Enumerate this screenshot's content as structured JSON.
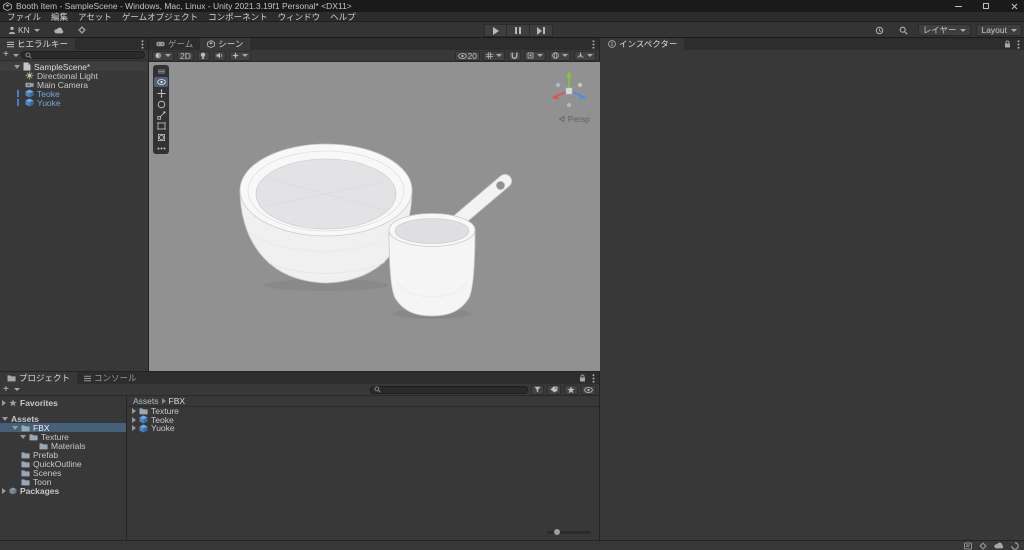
{
  "window": {
    "title": "Booth Item - SampleScene - Windows, Mac, Linux - Unity 2021.3.19f1 Personal* <DX11>"
  },
  "menu": {
    "items": [
      "ファイル",
      "編集",
      "アセット",
      "ゲームオブジェクト",
      "コンポーネント",
      "ウィンドウ",
      "ヘルプ"
    ]
  },
  "toolbar": {
    "account_label": "KN",
    "layers_label": "レイヤー",
    "layout_label": "Layout"
  },
  "hierarchy": {
    "tab_label": "ヒエラルキー",
    "create_label": "+",
    "scene_name": "SampleScene*",
    "items": [
      {
        "name": "Directional Light"
      },
      {
        "name": "Main Camera"
      },
      {
        "name": "Teoke"
      },
      {
        "name": "Yuoke"
      }
    ]
  },
  "scene": {
    "tab_game": "ゲーム",
    "tab_scene": "シーン",
    "toggle_2d": "2D",
    "visibility_count": "20",
    "persp_label": "Persp"
  },
  "inspector": {
    "tab_label": "インスペクター"
  },
  "project": {
    "tab_project": "プロジェクト",
    "tab_console": "コンソール",
    "create_label": "+",
    "breadcrumb": {
      "root": "Assets",
      "current": "FBX"
    },
    "tree": [
      {
        "label": "Favorites"
      },
      {
        "label": "Assets"
      },
      {
        "label": "FBX"
      },
      {
        "label": "Texture"
      },
      {
        "label": "Materials"
      },
      {
        "label": "Prefab"
      },
      {
        "label": "QuickOutline"
      },
      {
        "label": "Scenes"
      },
      {
        "label": "Toon"
      },
      {
        "label": "Packages"
      }
    ],
    "files": [
      {
        "label": "Texture"
      },
      {
        "label": "Teoke"
      },
      {
        "label": "Yuoke"
      }
    ]
  },
  "colors": {
    "selection_blue": "#44607a",
    "prefab_text": "#7ba3d9",
    "prefab_marker": "#3d7dd2",
    "viewport_bg": "#919191"
  }
}
